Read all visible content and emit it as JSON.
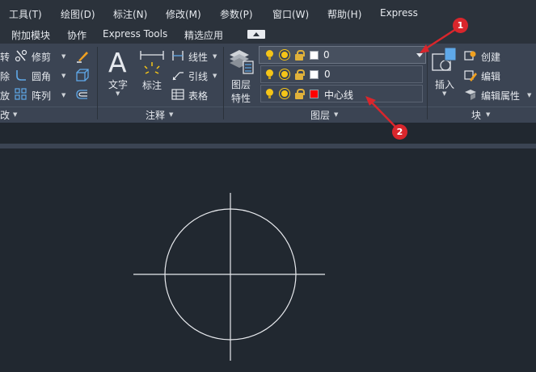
{
  "menubar": {
    "items": [
      "工具(T)",
      "绘图(D)",
      "标注(N)",
      "修改(M)",
      "参数(P)",
      "窗口(W)",
      "帮助(H)",
      "Express"
    ]
  },
  "tabs": {
    "items": [
      "附加模块",
      "协作",
      "Express Tools",
      "精选应用"
    ]
  },
  "modify_panel": {
    "items": [
      "修剪",
      "圆角",
      "阵列"
    ],
    "cut_left_chars": [
      "转",
      "除",
      "放"
    ],
    "title": "改"
  },
  "annotation_panel": {
    "text_label": "文字",
    "dim_label": "标注",
    "linear_label": "线性",
    "leader_label": "引线",
    "table_label": "表格",
    "title": "注释"
  },
  "layers_panel": {
    "properties_label_1": "图层",
    "properties_label_2": "特性",
    "current_layer": "0",
    "dropdown_items": [
      {
        "name": "0",
        "color": "#ffffff"
      },
      {
        "name": "中心线",
        "color": "#ff0000"
      }
    ],
    "title": "图层"
  },
  "block_panel": {
    "insert_label": "插入",
    "create_label": "创建",
    "edit_label": "编辑",
    "edit_attr_label": "编辑属性",
    "title": "块"
  },
  "annotations": {
    "badge_1": "1",
    "badge_2": "2",
    "accent": "#d9262c"
  }
}
